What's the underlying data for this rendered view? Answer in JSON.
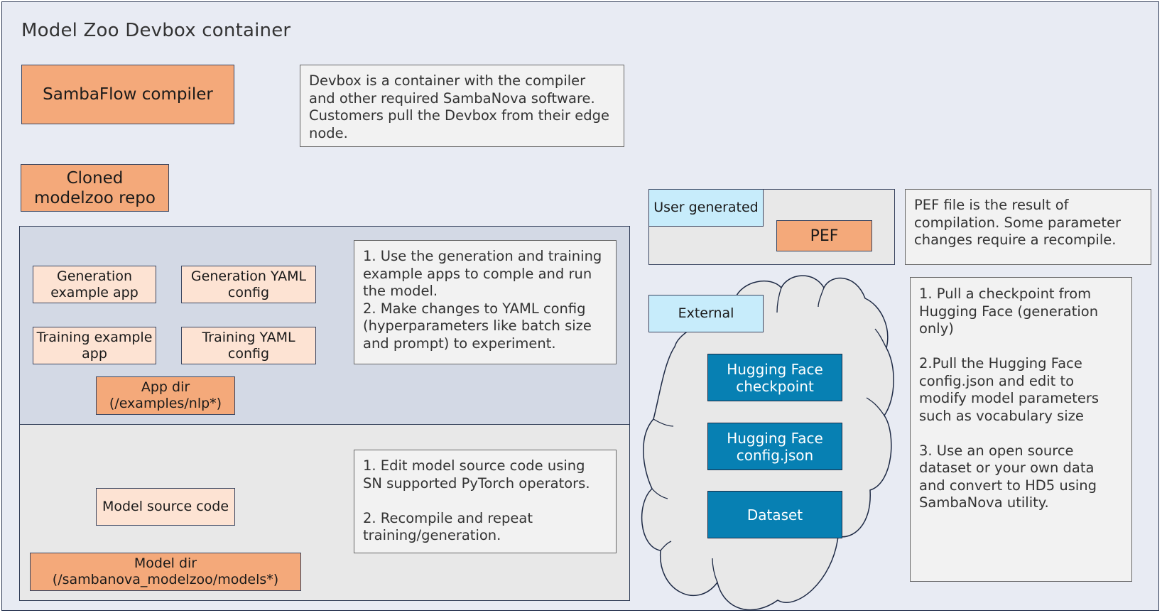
{
  "title": "Model Zoo Devbox container",
  "top": {
    "compiler": "SambaFlow compiler",
    "cloned_repo": "Cloned\nmodelzoo repo",
    "devbox_note": "Devbox is a container with the compiler and other required SambaNova software. Customers pull the Devbox from their edge node."
  },
  "app_panel": {
    "generation_app": "Generation example app",
    "generation_yaml": "Generation YAML config",
    "training_app": "Training example app",
    "training_yaml": "Training YAML config",
    "app_dir": "App dir (/examples/nlp*)",
    "note": "1. Use the generation and training example apps to comple and run the model.\n2. Make changes to YAML config (hyperparameters like batch size and prompt) to experiment."
  },
  "model_panel": {
    "model_source": "Model source code",
    "model_dir": "Model dir (/sambanova_modelzoo/models*)",
    "note": "1. Edit model source code using SN supported PyTorch operators.\n\n2. Recompile and repeat training/generation."
  },
  "user_generated": {
    "label": "User generated",
    "pef": "PEF",
    "note": "PEF file is the result of compilation. Some parameter changes require a recompile."
  },
  "external": {
    "label": "External",
    "items": [
      "Hugging Face checkpoint",
      "Hugging Face config.json",
      "Dataset"
    ],
    "note": "1. Pull a checkpoint from Hugging Face (generation only)\n\n2.Pull the Hugging Face config.json and edit to modify model parameters such as vocabulary size\n\n3. Use an open source dataset or your own data and convert to HD5 using SambaNova utility."
  },
  "colors": {
    "orange_box": "#f4a97a",
    "peach_box": "#fde3d3",
    "cyan_box": "#c7ecfb",
    "blue_box": "#0780b3",
    "background": "#e8ebf3",
    "border": "#2d3a55"
  }
}
